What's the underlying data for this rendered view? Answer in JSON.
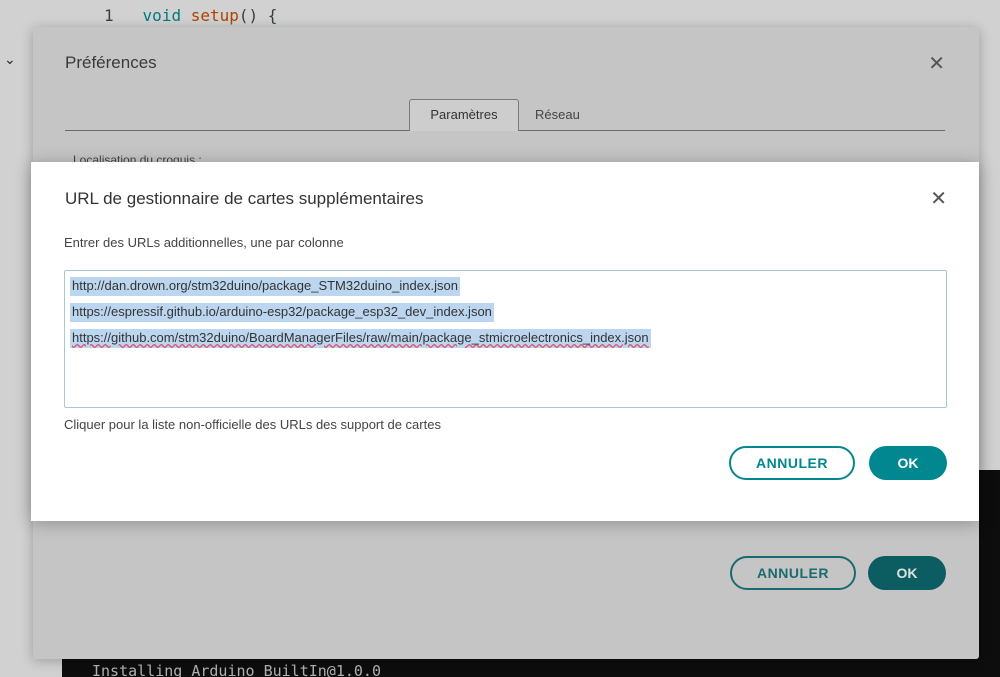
{
  "ide": {
    "code_line_number": "1",
    "code_keyword": "void",
    "code_function": "setup",
    "code_rest": "() {",
    "console_text": "Installing Arduino_BuiltIn@1.0.0",
    "colors": {
      "console_bg": "#111111",
      "keyword": "#00979c",
      "function": "#d35400"
    }
  },
  "preferences": {
    "title": "Préférences",
    "close_icon": "close-icon",
    "tabs": [
      {
        "label": "Paramètres",
        "active": true
      },
      {
        "label": "Réseau",
        "active": false
      }
    ],
    "sketchbook_label": "Localisation du croquis :",
    "cancel_label": "ANNULER",
    "ok_label": "OK"
  },
  "url_dialog": {
    "title": "URL de gestionnaire de cartes supplémentaires",
    "close_icon": "close-icon",
    "instructions": "Entrer des URLs additionnelles, une par colonne",
    "urls": [
      "http://dan.drown.org/stm32duino/package_STM32duino_index.json",
      "https://espressif.github.io/arduino-esp32/package_esp32_dev_index.json",
      "https://github.com/stm32duino/BoardManagerFiles/raw/main/package_stmicroelectronics_index.json"
    ],
    "unofficial_list_link": "Cliquer pour la liste non-officielle des URLs des support de cartes",
    "cancel_label": "ANNULER",
    "ok_label": "OK",
    "colors": {
      "accent": "#00878f",
      "selection": "#bcd6f0"
    }
  }
}
